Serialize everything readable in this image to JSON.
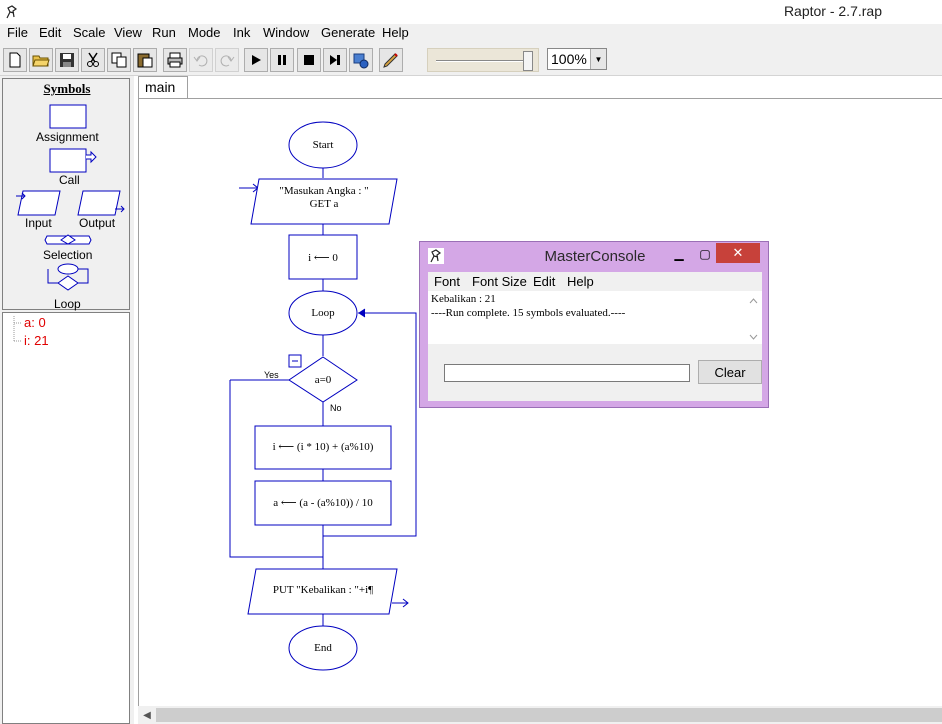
{
  "window": {
    "title": "Raptor - 2.7.rap",
    "app_icon": "raptor-icon"
  },
  "menu": [
    "File",
    "Edit",
    "Scale",
    "View",
    "Run",
    "Mode",
    "Ink",
    "Window",
    "Generate",
    "Help"
  ],
  "toolbar": {
    "buttons": [
      "new-icon",
      "open-icon",
      "save-icon",
      "cut-icon",
      "copy-icon",
      "paste-icon",
      "print-icon",
      "undo-icon",
      "redo-icon",
      "play-icon",
      "pause-icon",
      "stop-icon",
      "step-icon",
      "test-server-icon",
      "pen-icon"
    ],
    "zoom": "100%",
    "speed_level": 0.95
  },
  "symbols_panel": {
    "title": "Symbols",
    "items": [
      "Assignment",
      "Call",
      "Input",
      "Output",
      "Selection",
      "Loop"
    ]
  },
  "variables": [
    "a: 0",
    "i: 21"
  ],
  "tabs": [
    "main"
  ],
  "flowchart": {
    "start": "Start",
    "input_prompt": "\"Masukan Angka : \"",
    "input_get": "GET a",
    "assign1": "i ⟵ 0",
    "loop": "Loop",
    "condition": "a=0",
    "yes": "Yes",
    "no": "No",
    "assign2": "i ⟵ (i * 10) + (a%10)",
    "assign3": "a ⟵ (a - (a%10)) / 10",
    "output": "PUT \"Kebalikan : \"+i¶",
    "end": "End"
  },
  "console": {
    "title": "MasterConsole",
    "menu": [
      "Font",
      "Font Size",
      "Edit",
      "Help"
    ],
    "output_lines": [
      "Kebalikan : 21",
      "----Run complete.  15 symbols evaluated.----"
    ],
    "input_value": "",
    "clear_label": "Clear",
    "accent": "#d4a7e6",
    "close_color": "#c7413a"
  },
  "colors": {
    "flow_stroke": "#0000c0",
    "variable_text": "#e00000"
  }
}
